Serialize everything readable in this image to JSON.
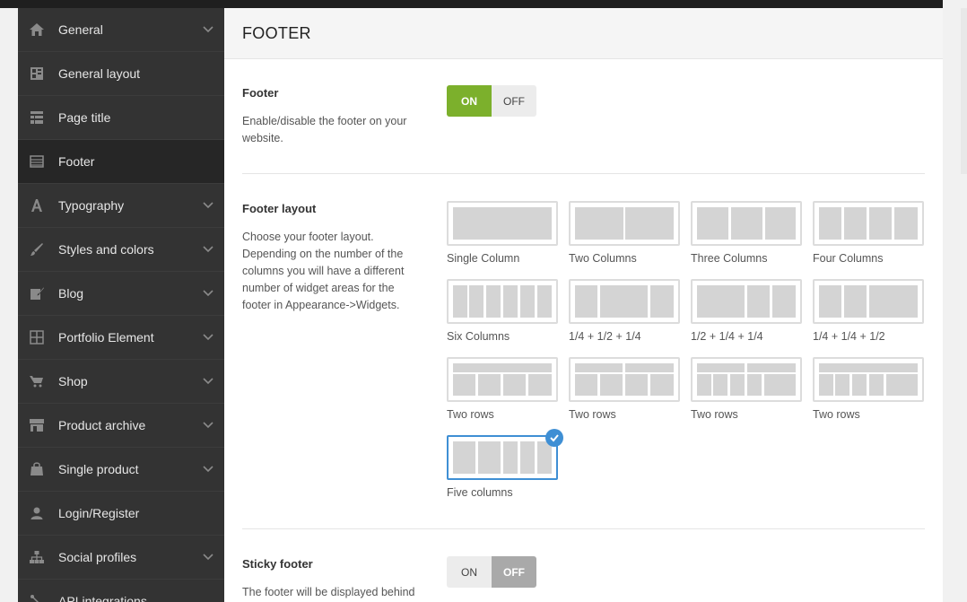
{
  "sidebar": {
    "items": [
      {
        "label": "General",
        "icon": "home-icon",
        "chevron": true,
        "active": false
      },
      {
        "label": "General layout",
        "icon": "layout-icon",
        "chevron": false,
        "active": false
      },
      {
        "label": "Page title",
        "icon": "page-title-icon",
        "chevron": false,
        "active": false
      },
      {
        "label": "Footer",
        "icon": "footer-icon",
        "chevron": false,
        "active": true
      },
      {
        "label": "Typography",
        "icon": "typography-icon",
        "chevron": true,
        "active": false
      },
      {
        "label": "Styles and colors",
        "icon": "brush-icon",
        "chevron": true,
        "active": false
      },
      {
        "label": "Blog",
        "icon": "blog-icon",
        "chevron": true,
        "active": false
      },
      {
        "label": "Portfolio Element",
        "icon": "grid-icon",
        "chevron": true,
        "active": false
      },
      {
        "label": "Shop",
        "icon": "cart-icon",
        "chevron": true,
        "active": false
      },
      {
        "label": "Product archive",
        "icon": "store-icon",
        "chevron": true,
        "active": false
      },
      {
        "label": "Single product",
        "icon": "bag-icon",
        "chevron": true,
        "active": false
      },
      {
        "label": "Login/Register",
        "icon": "user-icon",
        "chevron": false,
        "active": false
      },
      {
        "label": "Social profiles",
        "icon": "sitemap-icon",
        "chevron": true,
        "active": false
      },
      {
        "label": "API integrations",
        "icon": "plug-icon",
        "chevron": false,
        "active": false
      }
    ]
  },
  "main": {
    "title": "FOOTER",
    "footer_option": {
      "title": "Footer",
      "desc": "Enable/disable the footer on your website.",
      "on_label": "ON",
      "off_label": "OFF",
      "value": "ON"
    },
    "layout_option": {
      "title": "Footer layout",
      "desc": "Choose your footer layout. Depending on the number of the columns you will have a different number of widget areas for the footer in Appearance->Widgets.",
      "layouts": [
        {
          "label": "Single Column",
          "selected": false
        },
        {
          "label": "Two Columns",
          "selected": false
        },
        {
          "label": "Three Columns",
          "selected": false
        },
        {
          "label": "Four Columns",
          "selected": false
        },
        {
          "label": "Six Columns",
          "selected": false
        },
        {
          "label": "1/4 + 1/2 + 1/4",
          "selected": false
        },
        {
          "label": "1/2 + 1/4 + 1/4",
          "selected": false
        },
        {
          "label": "1/4 + 1/4 + 1/2",
          "selected": false
        },
        {
          "label": "Two rows",
          "selected": false
        },
        {
          "label": "Two rows",
          "selected": false
        },
        {
          "label": "Two rows",
          "selected": false
        },
        {
          "label": "Two rows",
          "selected": false
        },
        {
          "label": "Five columns",
          "selected": true
        }
      ]
    },
    "sticky_option": {
      "title": "Sticky footer",
      "desc": "The footer will be displayed behind",
      "on_label": "ON",
      "off_label": "OFF",
      "value": "OFF"
    }
  },
  "colors": {
    "sidebar_bg": "#333333",
    "active_item_bg": "#262626",
    "toggle_on": "#7cb02c",
    "toggle_off_active": "#a9a9a9",
    "selected_layout": "#3f8fd4"
  }
}
